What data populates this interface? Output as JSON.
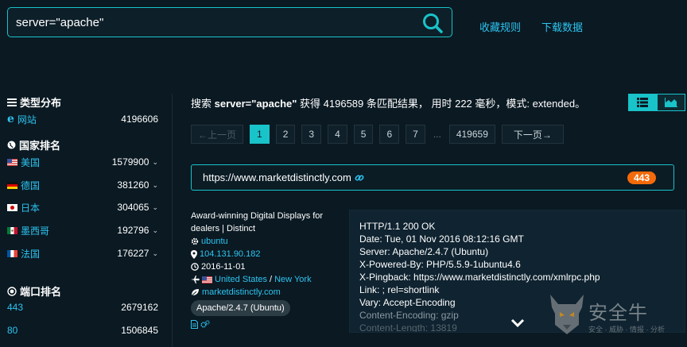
{
  "search": {
    "query": "server=\"apache\""
  },
  "top_links": {
    "favorites": "收藏规则",
    "download": "下载数据"
  },
  "sidebar": {
    "type_title": "类型分布",
    "type_items": [
      {
        "label": "网站",
        "count": "4196606"
      }
    ],
    "country_title": "国家排名",
    "countries": [
      {
        "label": "美国",
        "count": "1579900"
      },
      {
        "label": "德国",
        "count": "381260"
      },
      {
        "label": "日本",
        "count": "304065"
      },
      {
        "label": "墨西哥",
        "count": "192796"
      },
      {
        "label": "法国",
        "count": "176227"
      }
    ],
    "port_title": "端口排名",
    "ports": [
      {
        "label": "443",
        "count": "2679162"
      },
      {
        "label": "80",
        "count": "1506845"
      }
    ]
  },
  "summary": {
    "prefix": "搜索",
    "query": "server=\"apache\"",
    "found": "获得 4196589 条匹配结果， 用时 222 毫秒，模式: extended。"
  },
  "pagination": {
    "prev": "←上一页",
    "pages": [
      "1",
      "2",
      "3",
      "4",
      "5",
      "6",
      "7"
    ],
    "ellipsis": "...",
    "last": "419659",
    "next": "下一页→",
    "current": "1"
  },
  "result": {
    "url": "https://www.marketdistinctly.com",
    "port": "443",
    "title": "Award-winning Digital Displays for dealers | Distinct",
    "os": "ubuntu",
    "ip": "104.131.90.182",
    "date": "2016-11-01",
    "country": "United States",
    "city": "New York",
    "domain": "marketdistinctly.com",
    "server": "Apache/2.4.7 (Ubuntu)",
    "headers": [
      "HTTP/1.1 200 OK",
      "Date: Tue, 01 Nov 2016 08:12:16 GMT",
      "Server: Apache/2.4.7 (Ubuntu)",
      "X-Powered-By: PHP/5.5.9-1ubuntu4.6",
      "X-Pingback: https://www.marketdistinctly.com/xmlrpc.php",
      "Link: ; rel=shortlink",
      "Vary: Accept-Encoding",
      "Content-Encoding: gzip",
      "Content-Length: 13819"
    ]
  },
  "watermark": {
    "text": "安全牛",
    "sub": "安全 · 威胁 · 情报 · 分析"
  },
  "colors": {
    "accent": "#19c3ca",
    "link": "#2ec4f0",
    "badge": "#f46a0a",
    "background": "#0a1922"
  }
}
